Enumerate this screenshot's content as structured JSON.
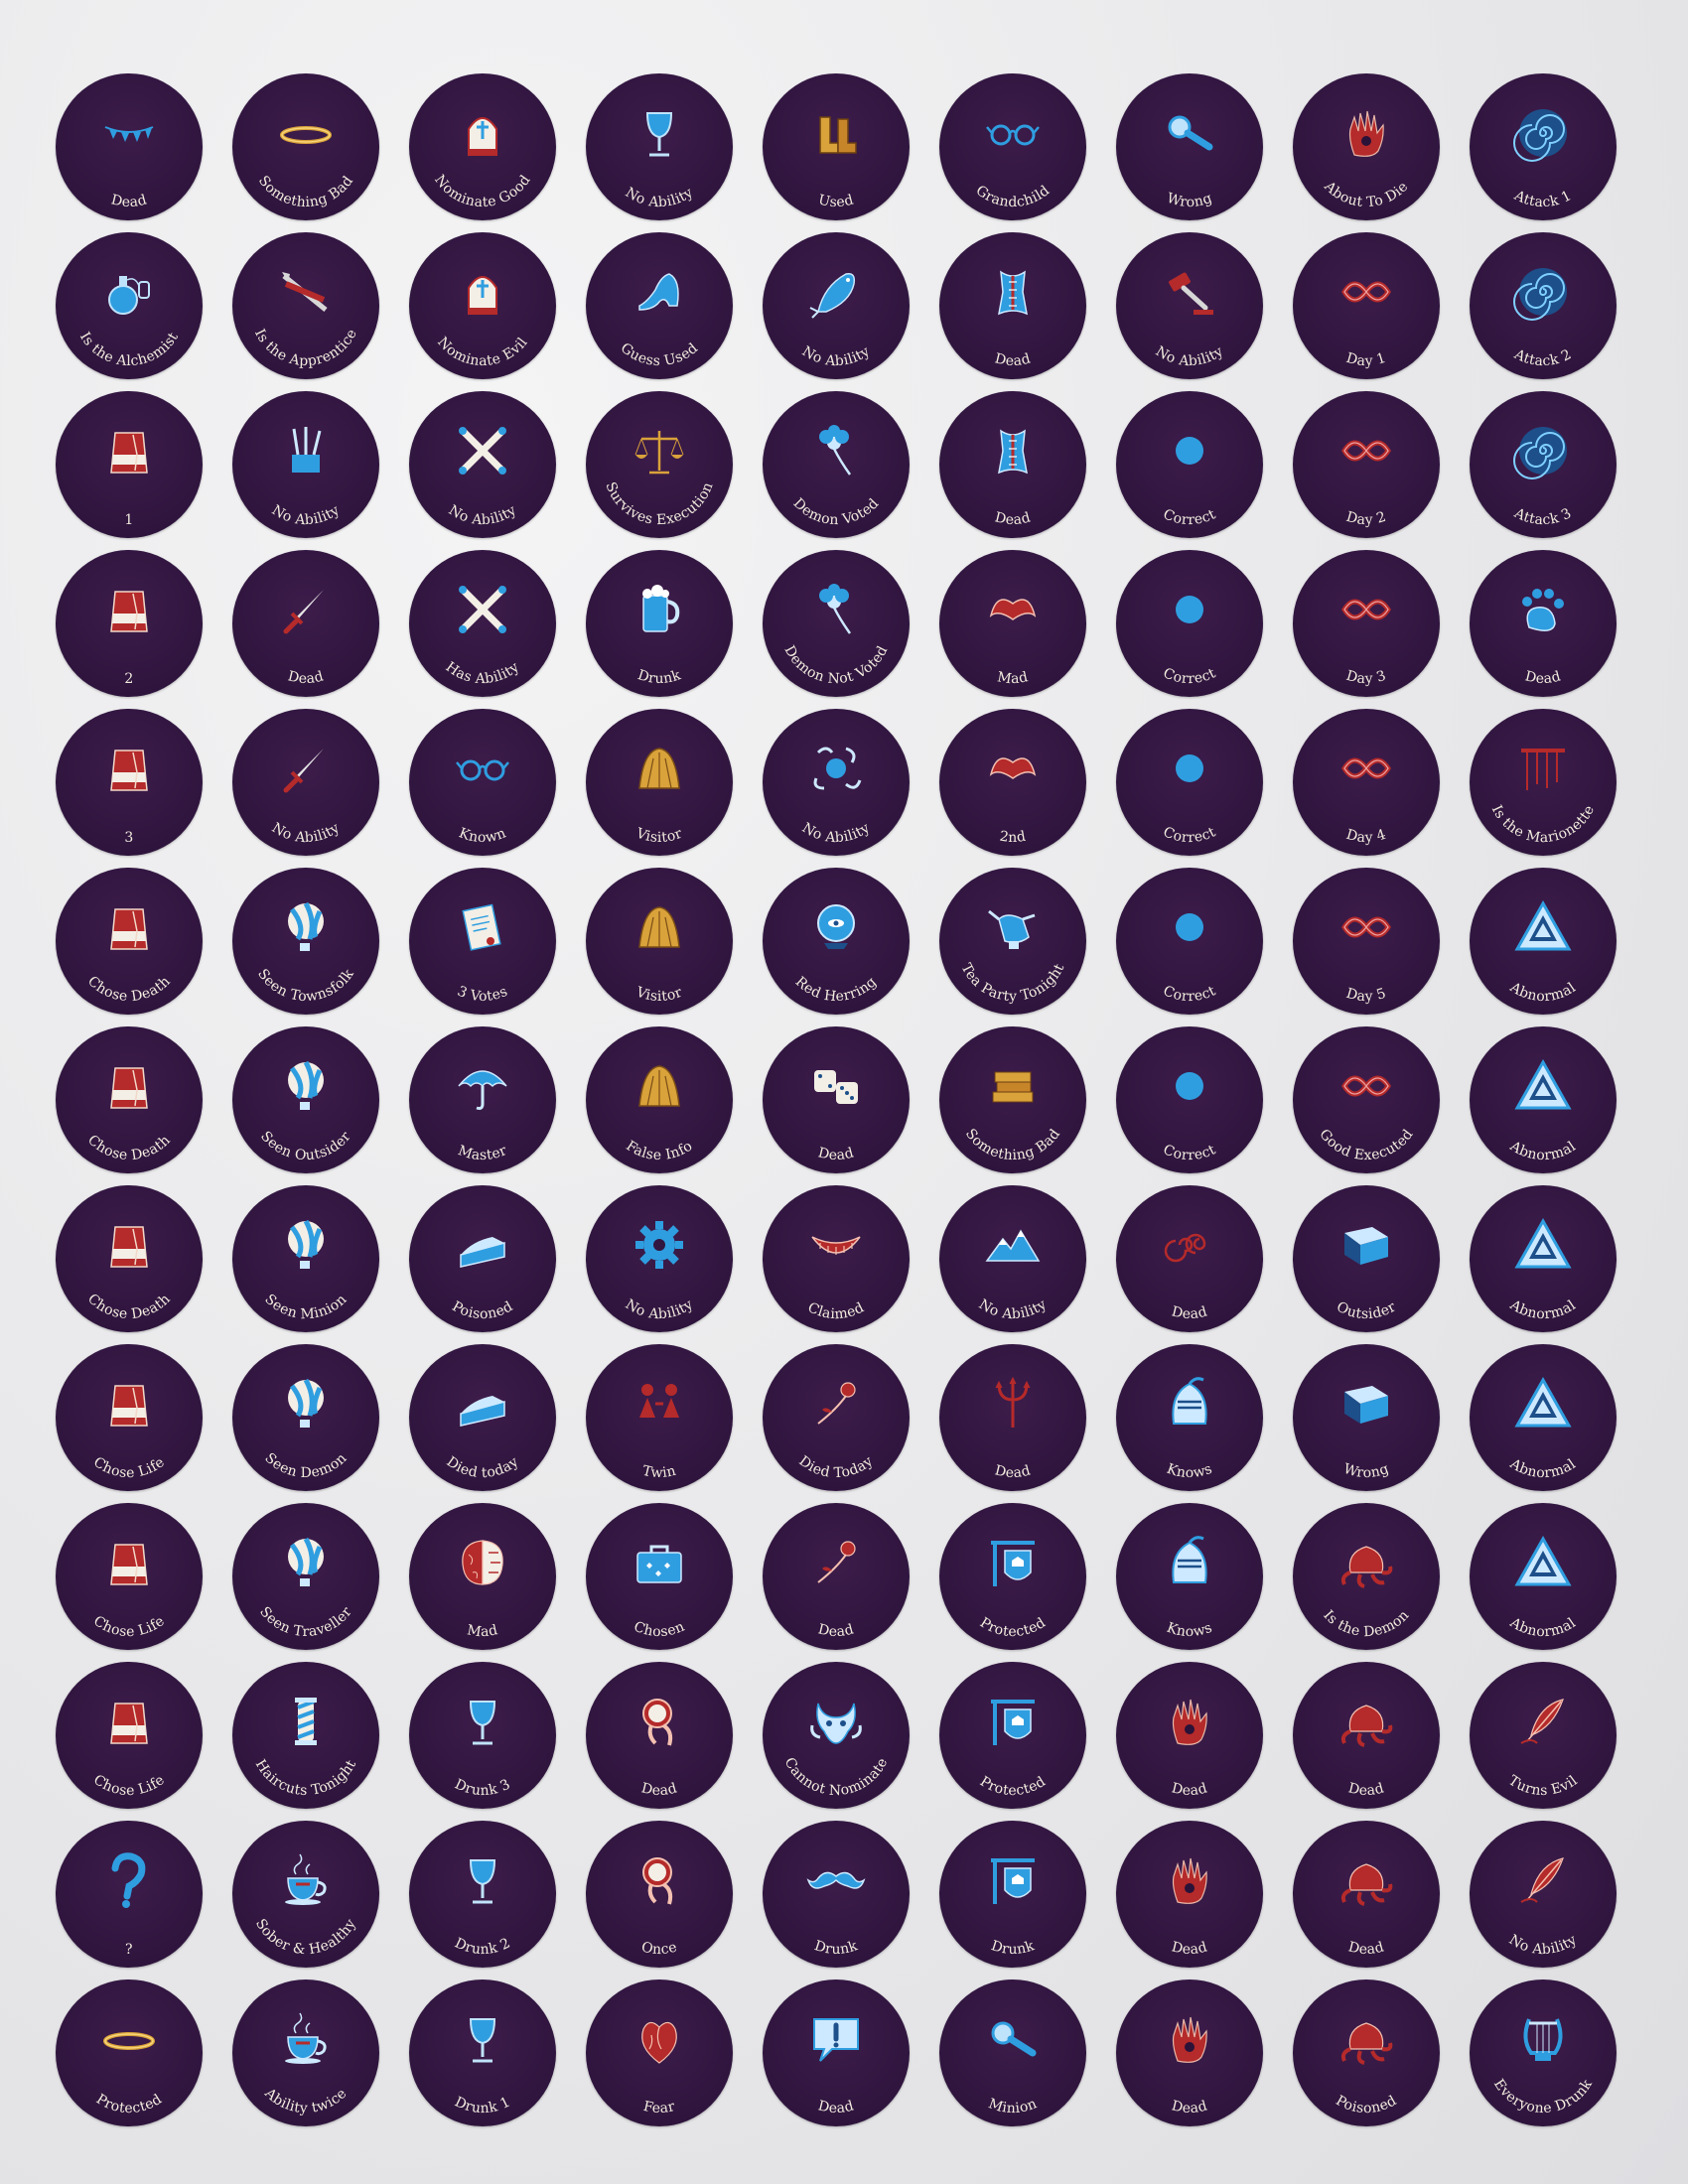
{
  "palette": {
    "token_bg": "#311640",
    "label": "#f2ecdf",
    "blue": "#2f9ee0",
    "red": "#b52a2a",
    "gold": "#d9a23a"
  },
  "tokens": [
    {
      "label": "Dead",
      "icon": "bunting-icon"
    },
    {
      "label": "Something Bad",
      "icon": "halo-icon"
    },
    {
      "label": "Nominate Good",
      "icon": "mitre-icon"
    },
    {
      "label": "No Ability",
      "icon": "goblet-icon"
    },
    {
      "label": "Used",
      "icon": "boots-icon"
    },
    {
      "label": "Grandchild",
      "icon": "spectacles-icon"
    },
    {
      "label": "Wrong",
      "icon": "magnifier-icon"
    },
    {
      "label": "About To Die",
      "icon": "hand-icon"
    },
    {
      "label": "Attack 1",
      "icon": "spiral-icon"
    },
    {
      "label": "Is the Alchemist",
      "icon": "potion-icon"
    },
    {
      "label": "Is the Apprentice",
      "icon": "tools-icon"
    },
    {
      "label": "Nominate Evil",
      "icon": "mitre-icon"
    },
    {
      "label": "Guess Used",
      "icon": "slipper-icon"
    },
    {
      "label": "No Ability",
      "icon": "fish-icon"
    },
    {
      "label": "Dead",
      "icon": "corset-icon"
    },
    {
      "label": "No Ability",
      "icon": "gavel-icon"
    },
    {
      "label": "Day 1",
      "icon": "knot-icon"
    },
    {
      "label": "Attack 2",
      "icon": "spiral-icon"
    },
    {
      "label": "1",
      "icon": "fez-icon"
    },
    {
      "label": "No Ability",
      "icon": "brushes-icon"
    },
    {
      "label": "No Ability",
      "icon": "crossbones-icon"
    },
    {
      "label": "Survives Execution",
      "icon": "scales-icon"
    },
    {
      "label": "Demon Voted",
      "icon": "flower-icon"
    },
    {
      "label": "Dead",
      "icon": "corset-icon"
    },
    {
      "label": "Correct",
      "icon": "pins-icon"
    },
    {
      "label": "Day 2",
      "icon": "knot-icon"
    },
    {
      "label": "Attack 3",
      "icon": "spiral-icon"
    },
    {
      "label": "2",
      "icon": "fez-icon"
    },
    {
      "label": "Dead",
      "icon": "dagger-icon"
    },
    {
      "label": "Has Ability",
      "icon": "crossbones-icon"
    },
    {
      "label": "Drunk",
      "icon": "tankard-icon"
    },
    {
      "label": "Demon Not Voted",
      "icon": "flower-icon"
    },
    {
      "label": "Mad",
      "icon": "lips-icon"
    },
    {
      "label": "Correct",
      "icon": "pins-icon"
    },
    {
      "label": "Day 3",
      "icon": "knot-icon"
    },
    {
      "label": "Dead",
      "icon": "paw-icon"
    },
    {
      "label": "3",
      "icon": "fez-icon"
    },
    {
      "label": "No Ability",
      "icon": "dagger-icon"
    },
    {
      "label": "Known",
      "icon": "spectacles-icon"
    },
    {
      "label": "Visitor",
      "icon": "haystack-icon"
    },
    {
      "label": "No Ability",
      "icon": "chaos-icon"
    },
    {
      "label": "2nd",
      "icon": "lips-icon"
    },
    {
      "label": "Correct",
      "icon": "pins-icon"
    },
    {
      "label": "Day 4",
      "icon": "knot-icon"
    },
    {
      "label": "Is the Marionette",
      "icon": "strings-icon"
    },
    {
      "label": "Chose Death",
      "icon": "fez-icon"
    },
    {
      "label": "Seen Townsfolk",
      "icon": "balloon-icon"
    },
    {
      "label": "3 Votes",
      "icon": "scroll-icon"
    },
    {
      "label": "Visitor",
      "icon": "haystack-icon"
    },
    {
      "label": "Red Herring",
      "icon": "crystal-ball-icon"
    },
    {
      "label": "Tea Party Tonight",
      "icon": "teapot-icon"
    },
    {
      "label": "Correct",
      "icon": "pins-icon"
    },
    {
      "label": "Day 5",
      "icon": "knot-icon"
    },
    {
      "label": "Abnormal",
      "icon": "triangle-icon"
    },
    {
      "label": "Chose Death",
      "icon": "fez-icon"
    },
    {
      "label": "Seen Outsider",
      "icon": "balloon-icon"
    },
    {
      "label": "Master",
      "icon": "umbrella-icon"
    },
    {
      "label": "False Info",
      "icon": "haystack-icon"
    },
    {
      "label": "Dead",
      "icon": "dice-icon"
    },
    {
      "label": "Something Bad",
      "icon": "books-icon"
    },
    {
      "label": "Correct",
      "icon": "pins-icon"
    },
    {
      "label": "Good Executed",
      "icon": "knot-icon"
    },
    {
      "label": "Abnormal",
      "icon": "triangle-icon"
    },
    {
      "label": "Chose Death",
      "icon": "fez-icon"
    },
    {
      "label": "Seen Minion",
      "icon": "balloon-icon"
    },
    {
      "label": "Poisoned",
      "icon": "pie-icon"
    },
    {
      "label": "No Ability",
      "icon": "gear-icon"
    },
    {
      "label": "Claimed",
      "icon": "grin-icon"
    },
    {
      "label": "No Ability",
      "icon": "mountain-icon"
    },
    {
      "label": "Dead",
      "icon": "swirl-icon"
    },
    {
      "label": "Outsider",
      "icon": "book-icon"
    },
    {
      "label": "Abnormal",
      "icon": "triangle-icon"
    },
    {
      "label": "Chose Life",
      "icon": "fez-icon"
    },
    {
      "label": "Seen Demon",
      "icon": "balloon-icon"
    },
    {
      "label": "Died today",
      "icon": "pie-icon"
    },
    {
      "label": "Twin",
      "icon": "twins-icon"
    },
    {
      "label": "Died Today",
      "icon": "rose-icon"
    },
    {
      "label": "Dead",
      "icon": "trident-icon"
    },
    {
      "label": "Knows",
      "icon": "helmet-icon"
    },
    {
      "label": "Wrong",
      "icon": "book-icon"
    },
    {
      "label": "Abnormal",
      "icon": "triangle-icon"
    },
    {
      "label": "Chose Life",
      "icon": "fez-icon"
    },
    {
      "label": "Seen Traveller",
      "icon": "balloon-icon"
    },
    {
      "label": "Mad",
      "icon": "brain-icon"
    },
    {
      "label": "Chosen",
      "icon": "suitcase-icon"
    },
    {
      "label": "Dead",
      "icon": "rose-icon"
    },
    {
      "label": "Protected",
      "icon": "sign-icon"
    },
    {
      "label": "Knows",
      "icon": "helmet-icon"
    },
    {
      "label": "Is the Demon",
      "icon": "tentacle-hat-icon"
    },
    {
      "label": "Abnormal",
      "icon": "triangle-icon"
    },
    {
      "label": "Chose Life",
      "icon": "fez-icon"
    },
    {
      "label": "Haircuts Tonight",
      "icon": "barber-pole-icon"
    },
    {
      "label": "Drunk 3",
      "icon": "goblet-icon"
    },
    {
      "label": "Dead",
      "icon": "hand-mirror-icon"
    },
    {
      "label": "Cannot Nominate",
      "icon": "bull-icon"
    },
    {
      "label": "Protected",
      "icon": "sign-icon"
    },
    {
      "label": "Dead",
      "icon": "hand-icon"
    },
    {
      "label": "Dead",
      "icon": "tentacle-hat-icon"
    },
    {
      "label": "Turns Evil",
      "icon": "quill-icon"
    },
    {
      "label": "?",
      "icon": "question-icon"
    },
    {
      "label": "Sober & Healthy",
      "icon": "teacup-icon"
    },
    {
      "label": "Drunk 2",
      "icon": "goblet-icon"
    },
    {
      "label": "Once",
      "icon": "hand-mirror-icon"
    },
    {
      "label": "Drunk",
      "icon": "moustache-icon"
    },
    {
      "label": "Drunk",
      "icon": "sign-icon"
    },
    {
      "label": "Dead",
      "icon": "hand-icon"
    },
    {
      "label": "Dead",
      "icon": "tentacle-hat-icon"
    },
    {
      "label": "No Ability",
      "icon": "quill-icon"
    },
    {
      "label": "Protected",
      "icon": "halo-icon"
    },
    {
      "label": "Ability twice",
      "icon": "teacup-icon"
    },
    {
      "label": "Drunk 1",
      "icon": "goblet-icon"
    },
    {
      "label": "Fear",
      "icon": "heart-icon"
    },
    {
      "label": "Dead",
      "icon": "speech-bubble-icon"
    },
    {
      "label": "Minion",
      "icon": "magnifier-icon"
    },
    {
      "label": "Dead",
      "icon": "hand-icon"
    },
    {
      "label": "Poisoned",
      "icon": "tentacle-hat-icon"
    },
    {
      "label": "Everyone Drunk",
      "icon": "lyre-icon"
    }
  ]
}
